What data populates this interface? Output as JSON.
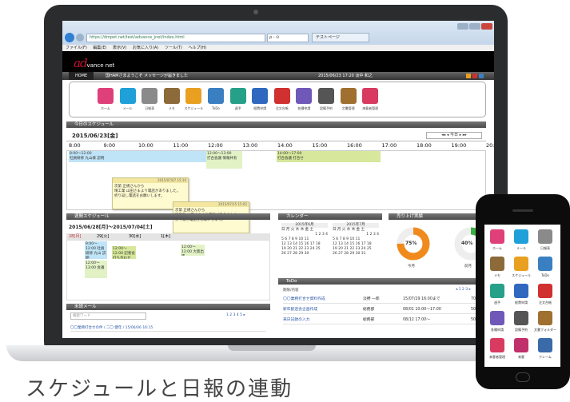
{
  "browser": {
    "url": "https://dmpet.net/test/advance_jnet/index.html",
    "search_text": "ρ - ⊙",
    "tab_title": "テストページ",
    "menu": [
      "ファイル(F)",
      "編集(E)",
      "表示(V)",
      "お気に入り(A)",
      "ツール(T)",
      "ヘルプ(H)"
    ]
  },
  "app": {
    "logo_main": "ad",
    "logo_sub": "vance net",
    "nav_home": "HOME",
    "nav_message": "国HAMさまようこそ メッセージが届きました",
    "nav_datetime": "2015/06/23 17:20 淡中 和之",
    "icons": [
      {
        "label": "ホーム",
        "color": "#e0407a"
      },
      {
        "label": "メール",
        "color": "#1fa0d8"
      },
      {
        "label": "日報表",
        "color": "#8a8a8a"
      },
      {
        "label": "メモ",
        "color": "#8c6a3a"
      },
      {
        "label": "スケジュール",
        "color": "#e9a020"
      },
      {
        "label": "ToDo",
        "color": "#3a7fc1"
      },
      {
        "label": "週予",
        "color": "#27a08a"
      },
      {
        "label": "経費申請",
        "color": "#3068c0"
      },
      {
        "label": "注文台帳",
        "color": "#d03030"
      },
      {
        "label": "各種申請",
        "color": "#7058b8"
      },
      {
        "label": "設備予約",
        "color": "#555"
      },
      {
        "label": "文書管理",
        "color": "#a07030"
      },
      {
        "label": "来客者管理",
        "color": "#d83a60"
      }
    ],
    "today": {
      "title": "今日のスケジュール",
      "date": "2015/06/23[金]",
      "times": [
        "8:00",
        "9:00",
        "10:00",
        "11:00",
        "12:00",
        "13:00",
        "14:00",
        "15:00",
        "16:00",
        "17:00",
        "18:00",
        "19:00",
        "20:00"
      ],
      "nav_today": "今日",
      "events": [
        {
          "time": "8:00〜12:00",
          "text": "社員研修 九山様 説明"
        },
        {
          "time": "12:00〜13:00",
          "text": "打合会議 情報共有"
        },
        {
          "time": "14:00〜17:00",
          "text": "打合会議 打合せ"
        }
      ]
    },
    "memos": [
      {
        "header": "2015/07/07 15:10",
        "lines": [
          "次第 正規さんから",
          "晴工業 山田さまより電話がありました。",
          "折り返し電話をお願いします。"
        ]
      },
      {
        "header": "2015/07/15 15:02",
        "lines": [
          "次第 正規さんから",
          "晴工業 山田さまより電話がありました。",
          "折り返し電話をお願いします。"
        ]
      }
    ],
    "weekly": {
      "title": "週間スケジュール",
      "range": "2015/06/28[月]〜2015/07/04[土]",
      "days": [
        "28[月]",
        "29[火]",
        "30[水]",
        "1[木]"
      ],
      "events": [
        "9:00〜12:00 社員研修 九山 説明",
        "12:00〜13:00 会議",
        "12:00〜12:00 記者会 打ち合わせ",
        "12:00〜12:00 大阪出張"
      ]
    },
    "calendar": {
      "title": "カレンダー",
      "month1": "2015年6月",
      "month2": "2015年7月",
      "weekdays": "日 月 火 水 木 金 土",
      "rows1": [
        "1 2 3 4",
        "5 6 7 8 9 10 11",
        "12 13 14 15 16 17 18",
        "19 20 21 22 23 24 25",
        "26 27 28 29 30"
      ],
      "rows2": [
        "1 2 3 4",
        "5 6 7 8 9 10 11",
        "12 13 14 15 16 17 18",
        "19 20 21 22 23 24 25",
        "26 27 28 29 30 31"
      ]
    },
    "sales": {
      "title": "売り上げ実績",
      "pct1": "75%",
      "label1": "今月",
      "pct2": "40%",
      "label2": "前月"
    },
    "todo": {
      "title": "ToDo",
      "header": "期限/内容",
      "items": [
        {
          "text": "〇〇業務打合せ資料作成",
          "who": "淡野 一郎",
          "due": "15/07/29 16:00まで",
          "pct": "70%"
        },
        {
          "text": "新年歓迎会企画作成",
          "who": "総務部",
          "due": "08/01 10:00〜17:00",
          "pct": "50%"
        },
        {
          "text": "来日記録の入力",
          "who": "総務部",
          "due": "08/12 17:00〜",
          "pct": "50%"
        }
      ]
    },
    "mail": {
      "title": "未読メール",
      "search_placeholder": "検索ワード",
      "pages": "1 2 3 4 5 ▸",
      "row": "〇〇業務打合せの件 / 二〇 健年 / 15/06/06 16:15"
    }
  },
  "phone": {
    "icons": [
      {
        "label": "ホーム",
        "color": "#e0407a"
      },
      {
        "label": "メール",
        "color": "#1fa0d8"
      },
      {
        "label": "日報表",
        "color": "#8a8a8a"
      },
      {
        "label": "メモ",
        "color": "#8c6a3a"
      },
      {
        "label": "スケジュール",
        "color": "#e9a020"
      },
      {
        "label": "ToDo",
        "color": "#3a7fc1"
      },
      {
        "label": "週予",
        "color": "#27a08a"
      },
      {
        "label": "経費申請",
        "color": "#3068c0"
      },
      {
        "label": "注文台帳",
        "color": "#d03030"
      },
      {
        "label": "各種申請",
        "color": "#7058b8"
      },
      {
        "label": "設備予約",
        "color": "#555"
      },
      {
        "label": "文書フォルダー",
        "color": "#a07030"
      },
      {
        "label": "来客者管理",
        "color": "#d83a60"
      },
      {
        "label": "来客",
        "color": "#c0306a"
      },
      {
        "label": "クレーム",
        "color": "#3a6aa8"
      }
    ]
  },
  "caption": "スケジュールと日報の連動"
}
